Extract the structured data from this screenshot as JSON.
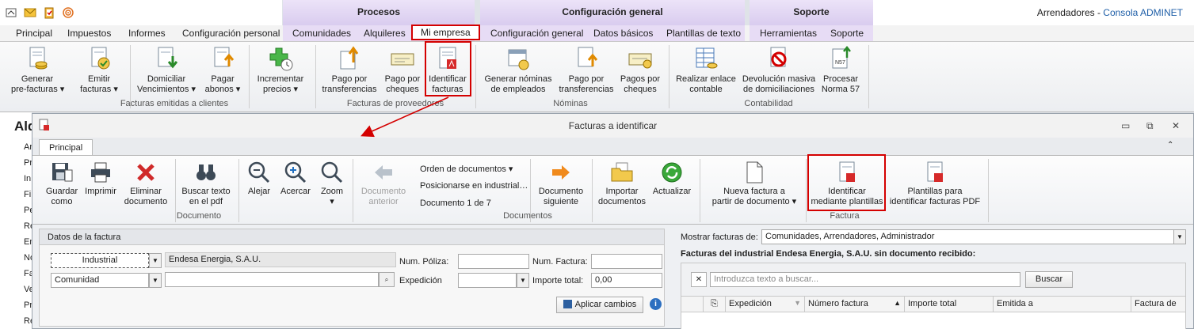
{
  "app": {
    "user_context": "Arrendadores",
    "separator": " - ",
    "console_link": "Consola ADMINET"
  },
  "context_groups": {
    "procesos": "Procesos",
    "configuracion": "Configuración general",
    "soporte": "Soporte"
  },
  "tabs": [
    "Principal",
    "Impuestos",
    "Informes",
    "Configuración personal",
    "Comunidades",
    "Alquileres",
    "Mi empresa",
    "Configuración general",
    "Datos básicos",
    "Plantillas de texto",
    "Herramientas",
    "Soporte"
  ],
  "ribbon": {
    "buttons": [
      {
        "line1": "Generar",
        "line2": "pre-facturas ▾"
      },
      {
        "line1": "Emitir",
        "line2": "facturas ▾"
      },
      {
        "line1": "Domiciliar",
        "line2": "Vencimientos ▾"
      },
      {
        "line1": "Pagar",
        "line2": "abonos ▾"
      },
      {
        "line1": "Incrementar",
        "line2": "precios ▾"
      },
      {
        "line1": "Pago por",
        "line2": "transferencias"
      },
      {
        "line1": "Pago por",
        "line2": "cheques"
      },
      {
        "line1": "Identificar",
        "line2": "facturas"
      },
      {
        "line1": "Generar nóminas",
        "line2": "de empleados"
      },
      {
        "line1": "Pago por",
        "line2": "transferencias"
      },
      {
        "line1": "Pagos por",
        "line2": "cheques"
      },
      {
        "line1": "Realizar enlace",
        "line2": "contable"
      },
      {
        "line1": "Devolución masiva",
        "line2": "de domiciliaciones"
      },
      {
        "line1": "Procesar",
        "line2": "Norma 57"
      }
    ],
    "groups": [
      "Facturas emitidas a clientes",
      "Facturas de proveedores",
      "Nóminas",
      "Contabilidad"
    ]
  },
  "left_pane": {
    "heading": "Alq",
    "items": [
      "Ar",
      "Pr",
      "In",
      "Fi",
      "Pe",
      "Re",
      "Em",
      "No",
      "Fa",
      "Ve",
      "Pr",
      "Re"
    ]
  },
  "window": {
    "title": "Facturas a identificar",
    "tab": "Principal",
    "buttons": [
      {
        "line1": "Guardar",
        "line2": "como"
      },
      {
        "line1": "Imprimir",
        "line2": ""
      },
      {
        "line1": "Eliminar",
        "line2": "documento"
      },
      {
        "line1": "Buscar texto",
        "line2": "en el pdf"
      },
      {
        "line1": "Alejar",
        "line2": ""
      },
      {
        "line1": "Acercar",
        "line2": ""
      },
      {
        "line1": "Zoom",
        "line2": "▾"
      },
      {
        "line1": "Documento",
        "line2": "anterior"
      },
      {
        "line1": "Documento",
        "line2": "siguiente"
      },
      {
        "line1": "Importar",
        "line2": "documentos"
      },
      {
        "line1": "Actualizar",
        "line2": ""
      },
      {
        "line1": "Nueva factura a",
        "line2": "partir de documento ▾"
      },
      {
        "line1": "Identificar",
        "line2": "mediante plantillas"
      },
      {
        "line1": "Plantillas para",
        "line2": "identificar facturas PDF"
      }
    ],
    "menu_items": [
      "Orden de documentos ▾",
      "Posicionarse en industrial…",
      "Documento 1 de 7"
    ],
    "groups": [
      "Documento",
      "Documentos",
      "Factura"
    ]
  },
  "form": {
    "title": "Datos de la factura",
    "type_value": "Industrial",
    "company": "Endesa Energia, S.A.U.",
    "comunidad_value": "Comunidad",
    "comunidad_text": "",
    "poliza_label": "Num. Póliza:",
    "poliza_value": "",
    "factura_label": "Num. Factura:",
    "factura_value": "",
    "expedicion_label": "Expedición",
    "expedicion_value": "",
    "importe_label": "Importe total:",
    "importe_value": "0,00",
    "apply_label": "Aplicar cambios"
  },
  "list": {
    "show_label": "Mostrar facturas de:",
    "show_value": "Comunidades, Arrendadores, Administrador",
    "heading": "Facturas del industrial Endesa Energia, S.A.U. sin documento recibido:",
    "search_placeholder": "Introduzca texto a buscar...",
    "search_button": "Buscar",
    "columns": [
      "Expedición",
      "Número factura",
      "Importe total",
      "Emitida a",
      "Factura de"
    ]
  },
  "colors": {
    "highlight": "#d40000",
    "context": "#e7dcf5",
    "link": "#1f5fa8"
  }
}
